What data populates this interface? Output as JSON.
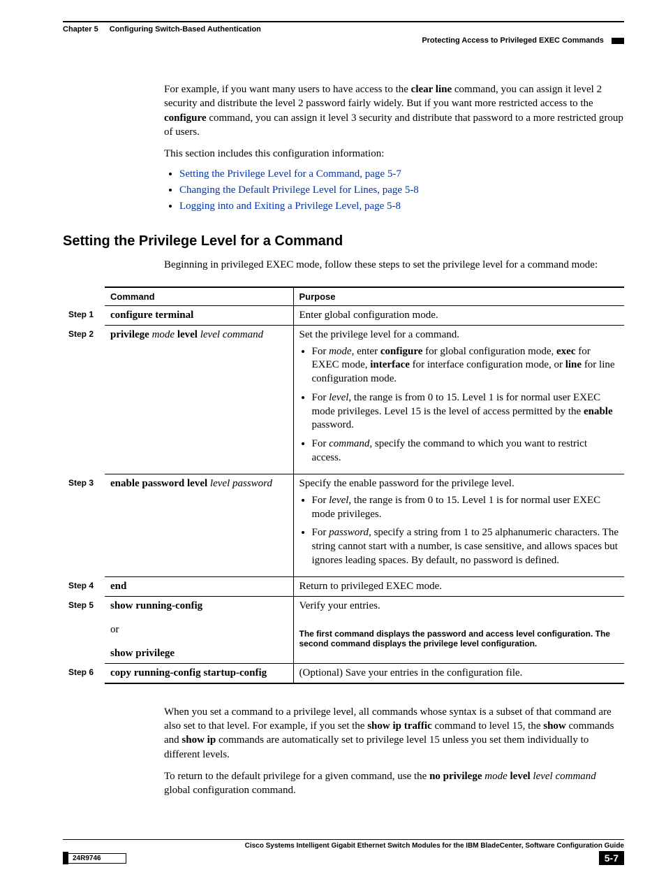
{
  "header": {
    "chapter": "Chapter 5",
    "chapter_title": "Configuring Switch-Based Authentication",
    "sub_title": "Protecting Access to Privileged EXEC Commands"
  },
  "intro": {
    "p1_a": "For example, if you want many users to have access to the ",
    "p1_bold1": "clear line",
    "p1_b": " command, you can assign it level 2 security and distribute the level 2 password fairly widely. But if you want more restricted access to the ",
    "p1_bold2": "configure",
    "p1_c": " command, you can assign it level 3 security and distribute that password to a more restricted group of users.",
    "p2": "This section includes this configuration information:",
    "links": [
      "Setting the Privilege Level for a Command, page 5-7",
      "Changing the Default Privilege Level for Lines, page 5-8",
      "Logging into and Exiting a Privilege Level, page 5-8"
    ]
  },
  "section_heading": "Setting the Privilege Level for a Command",
  "section_intro": "Beginning in privileged EXEC mode, follow these steps to set the privilege level for a command mode:",
  "table": {
    "head_command": "Command",
    "head_purpose": "Purpose",
    "steps": {
      "s1": {
        "label": "Step 1",
        "command": "configure terminal",
        "purpose_plain": "Enter global configuration mode."
      },
      "s2": {
        "label": "Step 2",
        "cmd_parts": {
          "b1": "privilege ",
          "i1": "mode ",
          "b2": "level ",
          "i2": "level command"
        },
        "purpose_plain": "Set the privilege level for a command.",
        "li1": {
          "a": "For ",
          "i1": "mode",
          "b1": ", enter ",
          "bold1": "configure",
          "c": " for global configuration mode, ",
          "bold2": "exec",
          "d": " for EXEC mode, ",
          "bold3": "interface",
          "e": " for interface configuration mode, or ",
          "bold4": "line",
          "f": " for line configuration mode."
        },
        "li2": {
          "a": "For ",
          "i1": "level",
          "b": ", the range is from 0 to 15. Level 1 is for normal user EXEC mode privileges. Level 15 is the level of access permitted by the ",
          "bold1": "enable",
          "c": " password."
        },
        "li3": {
          "a": "For ",
          "i1": "command",
          "b": ", specify the command to which you want to restrict access."
        }
      },
      "s3": {
        "label": "Step 3",
        "cmd_parts": {
          "b1": "enable password level ",
          "i1": "level password"
        },
        "purpose_plain": "Specify the enable password for the privilege level.",
        "li1": {
          "a": "For ",
          "i1": "level",
          "b": ", the range is from 0 to 15. Level 1 is for normal user EXEC mode privileges."
        },
        "li2": {
          "a": "For ",
          "i1": "password",
          "b": ", specify a string from 1 to 25 alphanumeric characters. The string cannot start with a number, is case sensitive, and allows spaces but ignores leading spaces. By default, no password is defined."
        }
      },
      "s4": {
        "label": "Step 4",
        "command": "end",
        "purpose_plain": "Return to privileged EXEC mode."
      },
      "s5": {
        "label": "Step 5",
        "cmd_line1": "show running-config",
        "cmd_or": "or",
        "cmd_line2": "show privilege",
        "purpose_plain": "Verify your entries.",
        "purpose_extra": "The first command displays the password and access level configuration. The second command displays the privilege level configuration."
      },
      "s6": {
        "label": "Step 6",
        "command": "copy running-config startup-config",
        "purpose_plain": "(Optional) Save your entries in the configuration file."
      }
    }
  },
  "after": {
    "p1_a": "When you set a command to a privilege level, all commands whose syntax is a subset of that command are also set to that level. For example, if you set the ",
    "p1_bold1": "show ip traffic",
    "p1_b": " command to level 15, the ",
    "p1_bold2": "show",
    "p1_c": " commands and ",
    "p1_bold3": "show ip",
    "p1_d": " commands are automatically set to privilege level 15 unless you set them individually to different levels.",
    "p2_a": "To return to the default privilege for a given command, use the ",
    "p2_bold1": "no privilege ",
    "p2_i1": "mode ",
    "p2_bold2": "level ",
    "p2_i2": "level command",
    "p2_b": " global configuration command."
  },
  "footer": {
    "guide": "Cisco Systems Intelligent Gigabit Ethernet Switch Modules for the IBM BladeCenter, Software Configuration Guide",
    "docnum": "24R9746",
    "pagenum": "5-7"
  }
}
